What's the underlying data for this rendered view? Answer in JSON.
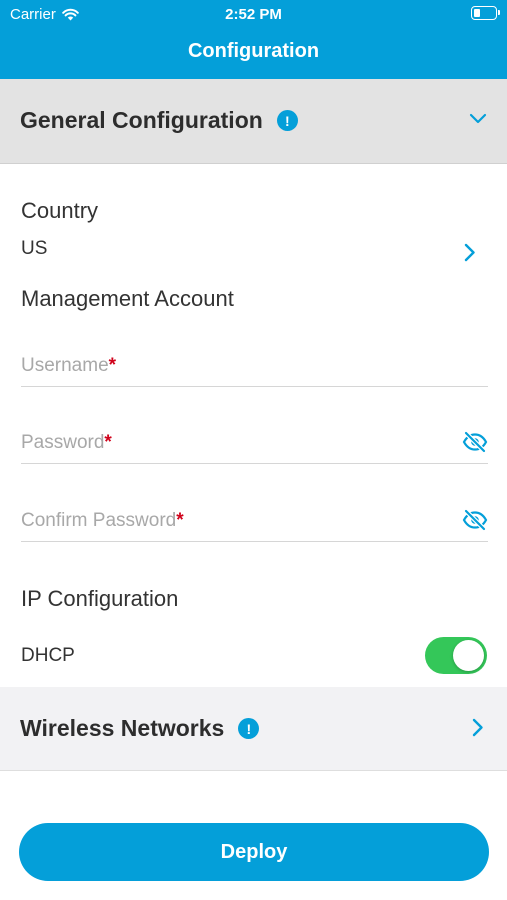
{
  "status_bar": {
    "carrier": "Carrier",
    "time": "2:52 PM",
    "battery_level": 0.3
  },
  "header": {
    "title": "Configuration",
    "background_color": "#049fd9"
  },
  "general_section": {
    "title": "General Configuration",
    "info_badge": "!",
    "expanded": true,
    "icon": "chevron-down-icon"
  },
  "country": {
    "label": "Country",
    "value": "US",
    "icon": "chevron-right-icon"
  },
  "management_account": {
    "label": "Management Account",
    "username": {
      "placeholder": "Username",
      "required_mark": "*",
      "value": ""
    },
    "password": {
      "placeholder": "Password",
      "required_mark": "*",
      "value": "",
      "icon": "eye-slash-icon"
    },
    "confirm_password": {
      "placeholder": "Confirm Password",
      "required_mark": "*",
      "value": "",
      "icon": "eye-slash-icon"
    }
  },
  "ip_configuration": {
    "label": "IP Configuration",
    "dhcp_label": "DHCP",
    "dhcp_enabled": true,
    "toggle_color": "#34c759"
  },
  "wireless_section": {
    "title": "Wireless Networks",
    "info_badge": "!",
    "icon": "chevron-right-icon"
  },
  "deploy_button": {
    "label": "Deploy"
  }
}
